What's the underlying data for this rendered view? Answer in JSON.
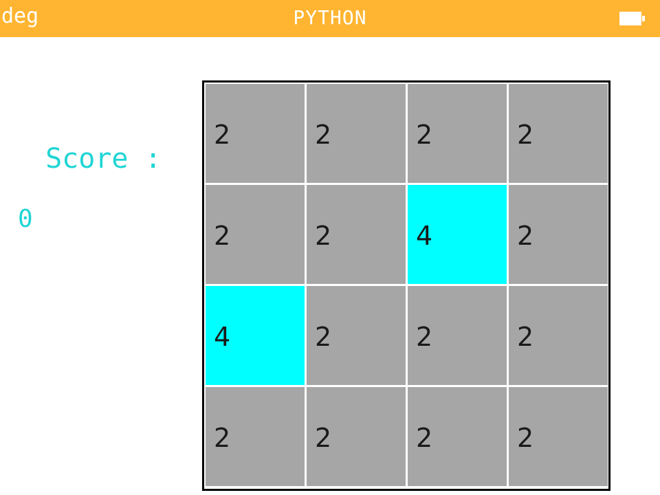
{
  "status_bar": {
    "mode": "deg",
    "title": "PYTHON",
    "background": "#FFB531",
    "battery_icon": "battery-full-icon"
  },
  "score": {
    "label": " Score :",
    "value": "0",
    "color": "#1FD5D5"
  },
  "board": {
    "tile_color": "#A6A6A6",
    "highlight_color": "#00FFFF",
    "rows": [
      [
        "2",
        "2",
        "2",
        "2"
      ],
      [
        "2",
        "2",
        "4",
        "2"
      ],
      [
        "4",
        "2",
        "2",
        "2"
      ],
      [
        "2",
        "2",
        "2",
        "2"
      ]
    ]
  }
}
